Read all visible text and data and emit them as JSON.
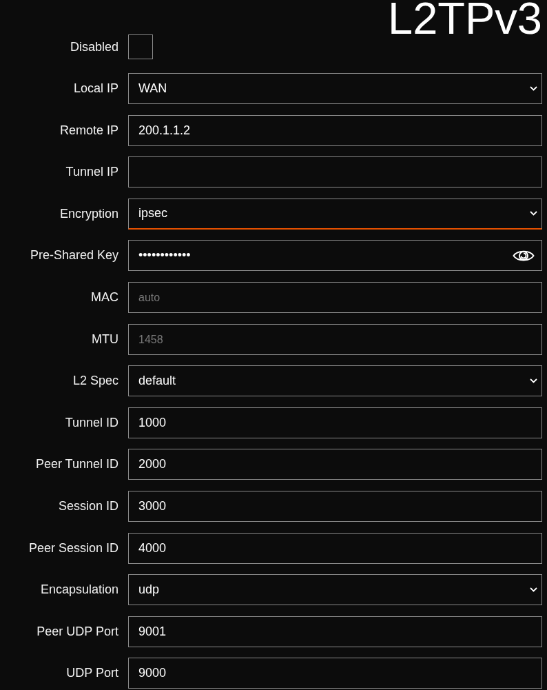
{
  "title": "L2TPv3",
  "fields": [
    {
      "label": "Disabled",
      "kind": "checkbox",
      "checked": false,
      "focused": false
    },
    {
      "label": "Local IP",
      "kind": "select",
      "value": "WAN",
      "focused": false
    },
    {
      "label": "Remote IP",
      "kind": "text",
      "value": "200.1.1.2",
      "focused": false
    },
    {
      "label": "Tunnel IP",
      "kind": "text",
      "focused": false
    },
    {
      "label": "Encryption",
      "kind": "select",
      "value": "ipsec",
      "focused": true
    },
    {
      "label": "Pre-Shared Key",
      "kind": "password",
      "value": "••••••••••••",
      "focused": false
    },
    {
      "label": "MAC",
      "kind": "text",
      "placeholder": "auto",
      "focused": false
    },
    {
      "label": "MTU",
      "kind": "text",
      "placeholder": "1458",
      "focused": false
    },
    {
      "label": "L2 Spec",
      "kind": "select",
      "value": "default",
      "focused": false
    },
    {
      "label": "Tunnel ID",
      "kind": "text",
      "value": "1000",
      "focused": false
    },
    {
      "label": "Peer Tunnel ID",
      "kind": "text",
      "value": "2000",
      "focused": false
    },
    {
      "label": "Session ID",
      "kind": "text",
      "value": "3000",
      "focused": false
    },
    {
      "label": "Peer Session ID",
      "kind": "text",
      "value": "4000",
      "focused": false
    },
    {
      "label": "Encapsulation",
      "kind": "select",
      "value": "udp",
      "focused": false
    },
    {
      "label": "Peer UDP Port",
      "kind": "text",
      "value": "9001",
      "focused": false
    },
    {
      "label": "UDP Port",
      "kind": "text",
      "value": "9000",
      "focused": false
    }
  ]
}
